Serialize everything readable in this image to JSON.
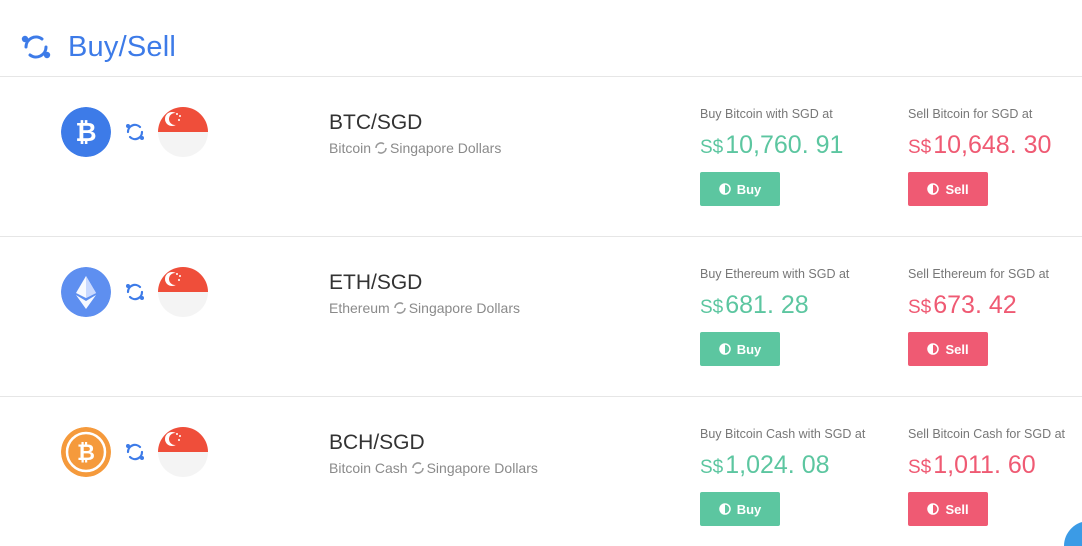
{
  "header": {
    "title": "Buy/Sell",
    "icon": "exchange-cycle-icon",
    "accent": "#3d7be8"
  },
  "colors": {
    "buy": "#5cc6a0",
    "sell": "#ef5a73",
    "btc": "#3d7be8",
    "eth": "#5e8ff0",
    "bch": "#f59a3c"
  },
  "rows": [
    {
      "pair": "BTC/SGD",
      "coin": "Bitcoin",
      "fiat": "Singapore Dollars",
      "coin_icon": "bitcoin-icon",
      "buy_label": "Buy Bitcoin with SGD at",
      "sell_label": "Sell Bitcoin for SGD at",
      "currency": "S$",
      "buy_price": "10,760. 91",
      "sell_price": "10,648. 30",
      "buy_button": "Buy",
      "sell_button": "Sell"
    },
    {
      "pair": "ETH/SGD",
      "coin": "Ethereum",
      "fiat": "Singapore Dollars",
      "coin_icon": "ethereum-icon",
      "buy_label": "Buy Ethereum with SGD at",
      "sell_label": "Sell Ethereum for SGD at",
      "currency": "S$",
      "buy_price": "681. 28",
      "sell_price": "673. 42",
      "buy_button": "Buy",
      "sell_button": "Sell"
    },
    {
      "pair": "BCH/SGD",
      "coin": "Bitcoin Cash",
      "fiat": "Singapore Dollars",
      "coin_icon": "bitcoin-cash-icon",
      "buy_label": "Buy Bitcoin Cash with SGD at",
      "sell_label": "Sell Bitcoin Cash for SGD at",
      "currency": "S$",
      "buy_price": "1,024. 08",
      "sell_price": "1,011. 60",
      "buy_button": "Buy",
      "sell_button": "Sell"
    }
  ]
}
